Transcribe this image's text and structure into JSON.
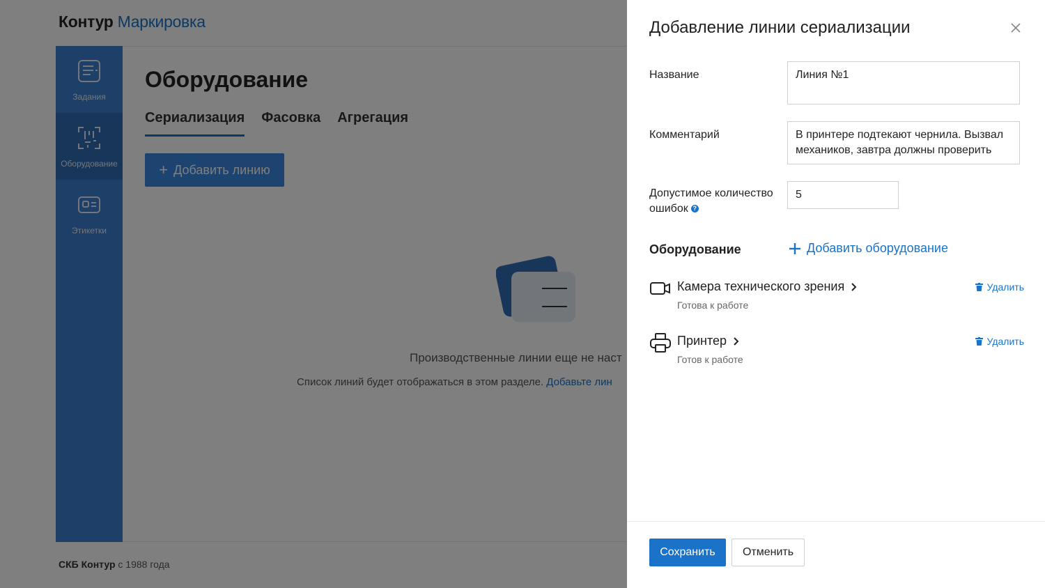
{
  "app": {
    "logo_part1": "Контур",
    "logo_part2": "Маркировка",
    "footer_company": "СКБ Контур",
    "footer_since": " с 1988 года"
  },
  "sidebar": {
    "items": [
      {
        "label": "Задания",
        "icon": "tasks-icon"
      },
      {
        "label": "Оборудование",
        "icon": "equipment-icon",
        "active": true
      },
      {
        "label": "Этикетки",
        "icon": "labels-icon"
      }
    ]
  },
  "main": {
    "title": "Оборудование",
    "tabs": [
      {
        "label": "Сериализация",
        "active": true
      },
      {
        "label": "Фасовка"
      },
      {
        "label": "Агрегация"
      }
    ],
    "add_button": "Добавить линию",
    "empty_title": "Производственные линии еще не наст",
    "empty_sub": "Список линий будет отображаться в этом разделе.",
    "empty_link": "Добавьте лин"
  },
  "panel": {
    "title": "Добавление линии сериализации",
    "name_label": "Название",
    "name_value": "Линия №1",
    "comment_label": "Комментарий",
    "comment_value": "В принтере подтекают чернила. Вызвал механиков, завтра должны проверить",
    "errors_label_1": "Допустимое количество",
    "errors_label_2": "ошибок",
    "errors_value": "5",
    "equipment_title": "Оборудование",
    "add_equipment": "Добавить оборудование",
    "equipment": [
      {
        "name": "Камера технического зрения",
        "status": "Готова к работе",
        "delete": "Удалить",
        "icon": "camera-icon"
      },
      {
        "name": "Принтер",
        "status": "Готов к работе",
        "delete": "Удалить",
        "icon": "printer-icon"
      }
    ],
    "save": "Сохранить",
    "cancel": "Отменить"
  },
  "colors": {
    "accent": "#1a73c8",
    "sidebar": "#3a7fd0",
    "overlay": "rgba(0,0,0,0.5)"
  }
}
